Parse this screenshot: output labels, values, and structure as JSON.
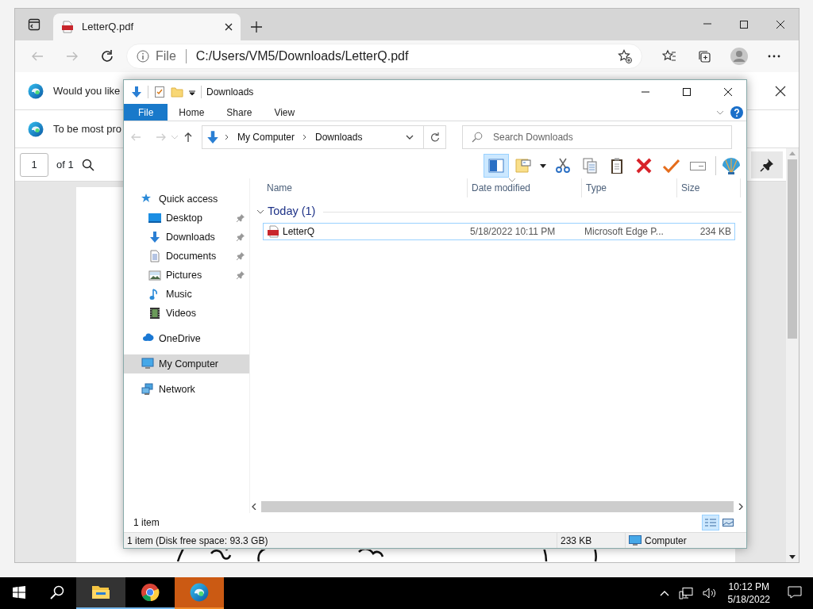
{
  "browser": {
    "tab": {
      "title": "LetterQ.pdf"
    },
    "address": {
      "scheme": "File",
      "url": "C:/Users/VM5/Downloads/LetterQ.pdf"
    },
    "infobars": [
      {
        "text": "Would you like"
      },
      {
        "text": "To be most pro"
      }
    ],
    "pdf_toolbar": {
      "page": "1",
      "page_count": "of 1"
    }
  },
  "explorer": {
    "title": "Downloads",
    "ribbon_tabs": [
      {
        "label": "File",
        "selected": true
      },
      {
        "label": "Home",
        "selected": false
      },
      {
        "label": "Share",
        "selected": false
      },
      {
        "label": "View",
        "selected": false
      }
    ],
    "breadcrumb": [
      "My Computer",
      "Downloads"
    ],
    "search": {
      "placeholder": "Search Downloads"
    },
    "toolbar_buttons": [
      {
        "selected": true
      },
      {
        "selected": false
      },
      {
        "selected": false
      },
      {
        "selected": false
      },
      {
        "selected": false
      },
      {
        "selected": false
      },
      {
        "selected": false
      },
      {
        "selected": false
      },
      {
        "selected": false
      }
    ],
    "sidebar": [
      {
        "label": "Quick access",
        "selected": false,
        "children": [
          {
            "label": "Desktop",
            "pinned": true,
            "selected": false
          },
          {
            "label": "Downloads",
            "pinned": true,
            "selected": false
          },
          {
            "label": "Documents",
            "pinned": true,
            "selected": false
          },
          {
            "label": "Pictures",
            "pinned": true,
            "selected": false
          },
          {
            "label": "Music",
            "pinned": false,
            "selected": false
          },
          {
            "label": "Videos",
            "pinned": false,
            "selected": false
          }
        ]
      },
      {
        "label": "OneDrive",
        "selected": false
      },
      {
        "label": "My Computer",
        "selected": true
      },
      {
        "label": "Network",
        "selected": false
      }
    ],
    "columns": [
      {
        "label": "Name",
        "sorted": false
      },
      {
        "label": "Date modified",
        "sorted": true
      },
      {
        "label": "Type",
        "sorted": false
      },
      {
        "label": "Size",
        "sorted": false
      }
    ],
    "groups": [
      {
        "label": "Today (1)",
        "expanded": true,
        "rows": [
          {
            "name": "LetterQ",
            "date_modified": "5/18/2022 10:11 PM",
            "type": "Microsoft Edge P...",
            "size": "234 KB",
            "focused": true
          }
        ]
      }
    ],
    "item_count": "1 item",
    "view_buttons": [
      {
        "selected": true
      },
      {
        "selected": false
      }
    ],
    "status_bar": {
      "summary": "1 item (Disk free space: 93.3 GB)",
      "size": "233 KB",
      "location": "Computer"
    }
  },
  "taskbar": {
    "apps": [
      {
        "selected": true,
        "attention": false
      },
      {
        "selected": false,
        "attention": false
      },
      {
        "selected": false,
        "attention": true
      }
    ],
    "clock": {
      "time": "10:12 PM",
      "date": "5/18/2022"
    }
  }
}
